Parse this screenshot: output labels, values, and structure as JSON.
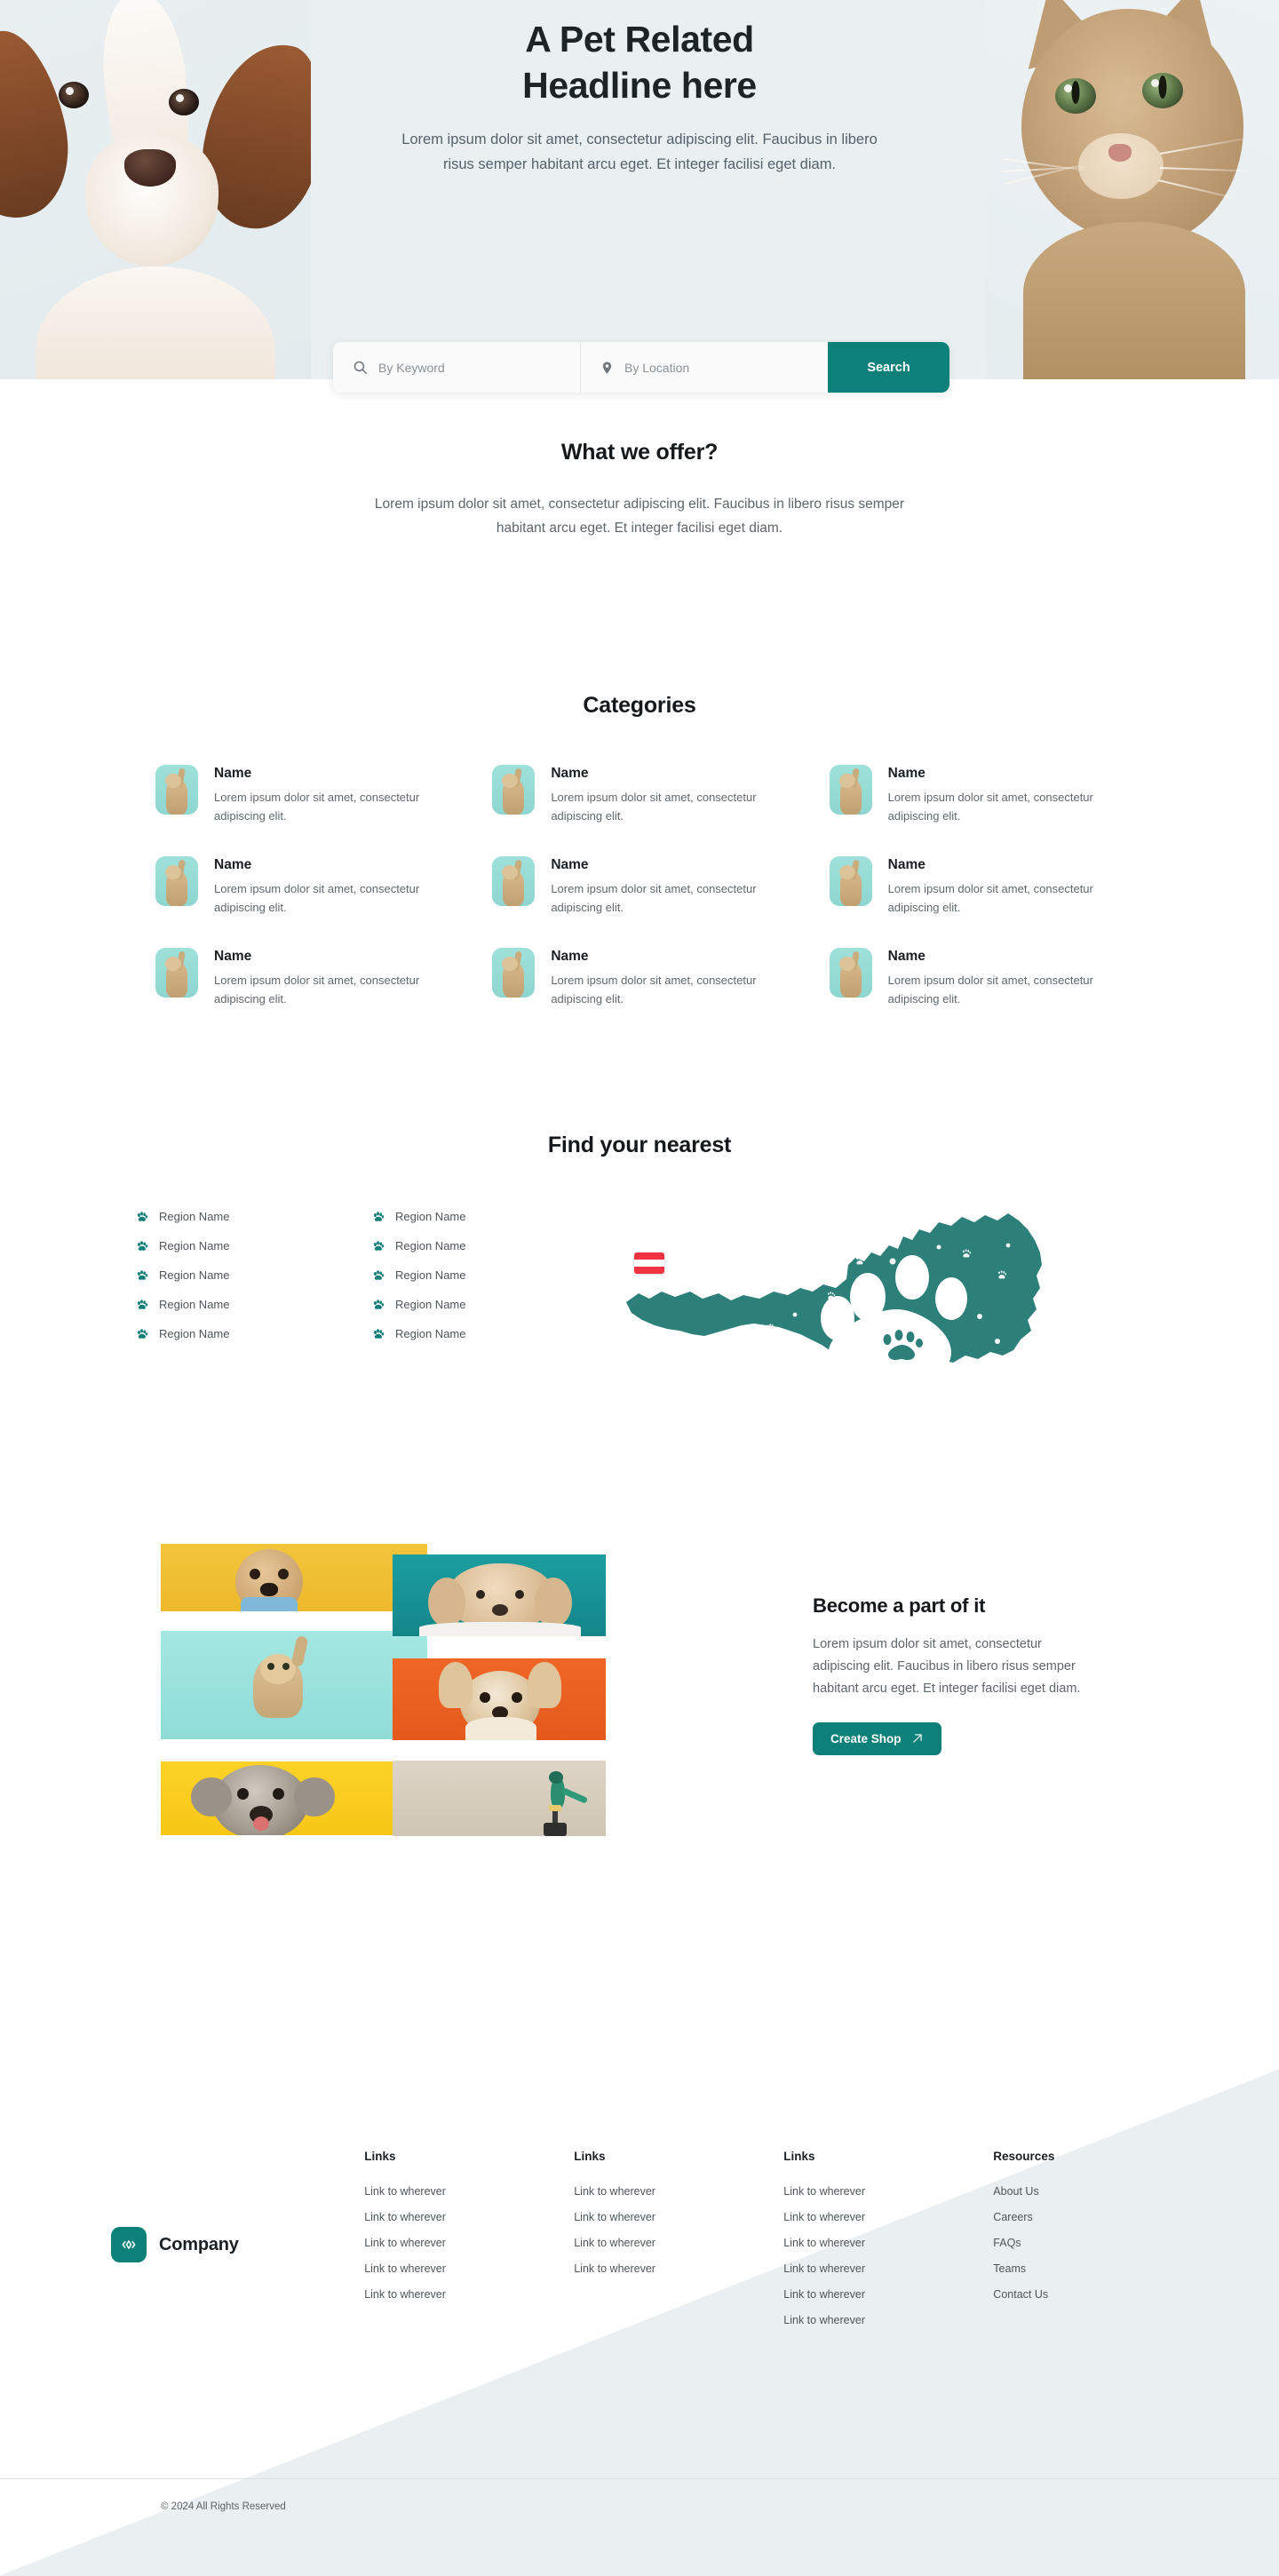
{
  "hero": {
    "title_line1": "A Pet Related",
    "title_line2": "Headline here",
    "subtitle": "Lorem ipsum dolor sit amet, consectetur adipiscing elit. Faucibus in libero risus semper habitant arcu eget. Et integer facilisi eget diam.",
    "left_image_alt": "brown and white dog portrait",
    "right_image_alt": "tabby kitten looking up"
  },
  "search": {
    "keyword_placeholder": "By Keyword",
    "keyword_value": "",
    "location_placeholder": "By Location",
    "location_value": "",
    "button_label": "Search",
    "keyword_icon": "search-icon",
    "location_icon": "map-pin-icon"
  },
  "offer": {
    "title": "What we offer?",
    "body": "Lorem ipsum dolor sit amet, consectetur adipiscing elit. Faucibus in libero risus semper habitant arcu eget. Et integer facilisi eget diam."
  },
  "categories": {
    "title": "Categories",
    "items": [
      {
        "name": "Name",
        "desc": "Lorem ipsum dolor sit amet, consectetur adipiscing elit."
      },
      {
        "name": "Name",
        "desc": "Lorem ipsum dolor sit amet, consectetur adipiscing elit."
      },
      {
        "name": "Name",
        "desc": "Lorem ipsum dolor sit amet, consectetur adipiscing elit."
      },
      {
        "name": "Name",
        "desc": "Lorem ipsum dolor sit amet, consectetur adipiscing elit."
      },
      {
        "name": "Name",
        "desc": "Lorem ipsum dolor sit amet, consectetur adipiscing elit."
      },
      {
        "name": "Name",
        "desc": "Lorem ipsum dolor sit amet, consectetur adipiscing elit."
      },
      {
        "name": "Name",
        "desc": "Lorem ipsum dolor sit amet, consectetur adipiscing elit."
      },
      {
        "name": "Name",
        "desc": "Lorem ipsum dolor sit amet, consectetur adipiscing elit."
      },
      {
        "name": "Name",
        "desc": "Lorem ipsum dolor sit amet, consectetur adipiscing elit."
      }
    ]
  },
  "nearest": {
    "title": "Find your nearest",
    "regions": [
      {
        "label": "Region Name"
      },
      {
        "label": "Region Name"
      },
      {
        "label": "Region Name"
      },
      {
        "label": "Region Name"
      },
      {
        "label": "Region Name"
      },
      {
        "label": "Region Name"
      },
      {
        "label": "Region Name"
      },
      {
        "label": "Region Name"
      },
      {
        "label": "Region Name"
      },
      {
        "label": "Region Name"
      }
    ],
    "map_alt": "Austria map with paw prints",
    "flag_alt": "Austria flag"
  },
  "gallery": {
    "images": [
      {
        "alt": "shih tzu puppy on yellow background"
      },
      {
        "alt": "lop rabbit on teal background"
      },
      {
        "alt": "kitten reaching up on mint background"
      },
      {
        "alt": "corgi puppy on orange background"
      },
      {
        "alt": "schnauzer puppy on yellow background"
      },
      {
        "alt": "green parrot on beige background"
      }
    ]
  },
  "become": {
    "title": "Become a part of it",
    "body": "Lorem ipsum dolor sit amet, consectetur adipiscing elit. Faucibus in libero risus semper habitant arcu eget. Et integer facilisi eget diam.",
    "button_label": "Create Shop",
    "button_icon": "arrow-up-right-icon"
  },
  "footer": {
    "brand": "Company",
    "logo_icon": "code-diamond-icon",
    "columns": [
      {
        "heading": "Links",
        "links": [
          "Link to wherever",
          "Link to wherever",
          "Link to wherever",
          "Link to wherever",
          "Link to wherever"
        ]
      },
      {
        "heading": "Links",
        "links": [
          "Link to wherever",
          "Link to wherever",
          "Link to wherever",
          "Link to wherever"
        ]
      },
      {
        "heading": "Links",
        "links": [
          "Link to wherever",
          "Link to wherever",
          "Link to wherever",
          "Link to wherever",
          "Link to wherever",
          "Link to wherever"
        ]
      },
      {
        "heading": "Resources",
        "links": [
          "About Us",
          "Careers",
          "FAQs",
          "Teams",
          "Contact Us"
        ]
      }
    ],
    "copyright": "© 2024 All Rights Reserved"
  },
  "colors": {
    "accent_teal": "#0c8079",
    "hero_bg": "#eaf0f2",
    "thumb_teal": "#8fd6d0",
    "text_dark": "#1b2024",
    "text_muted": "#5d666d"
  }
}
